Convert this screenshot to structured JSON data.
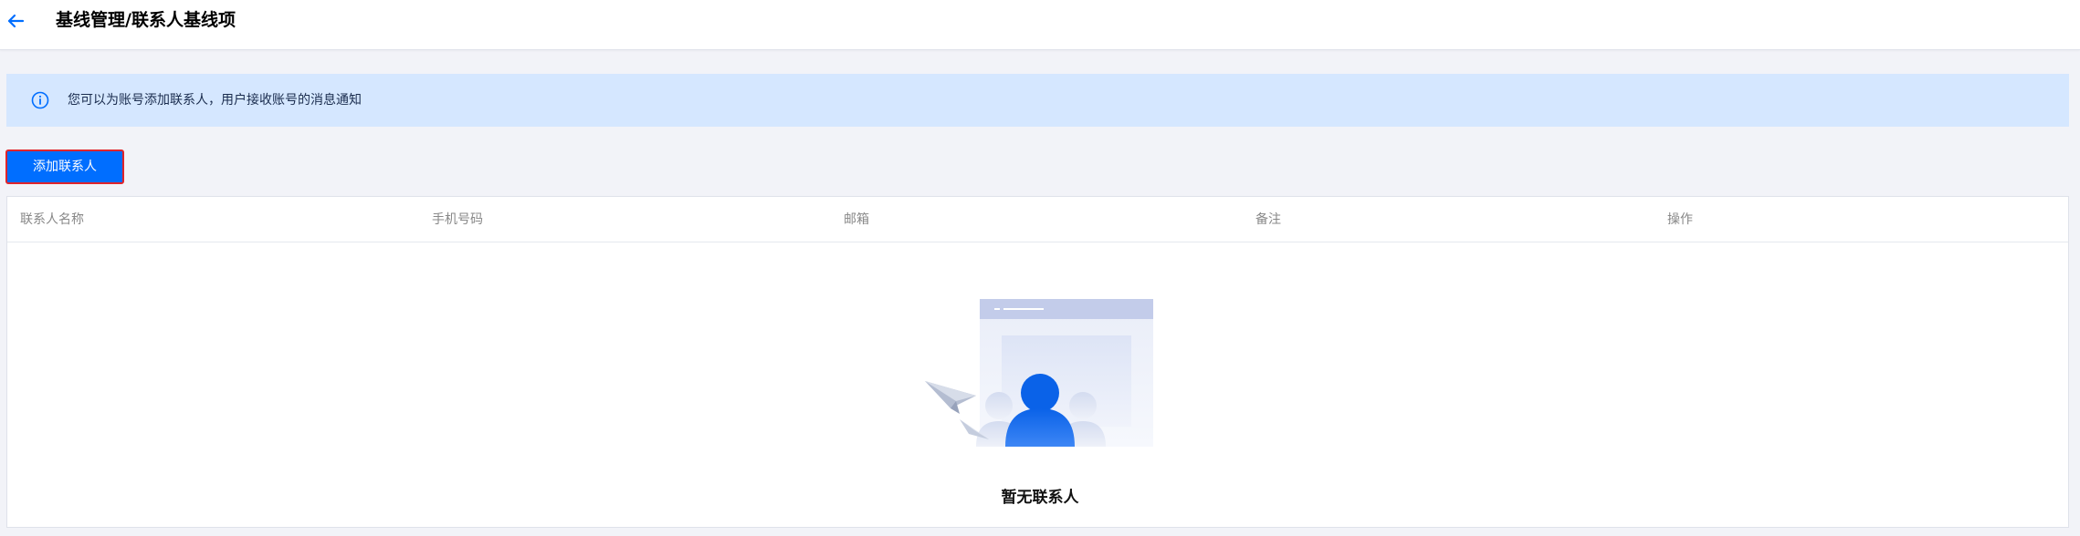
{
  "header": {
    "title": "基线管理/联系人基线项",
    "back_icon": "arrow-left-icon"
  },
  "notice": {
    "icon": "info-icon",
    "text": "您可以为账号添加联系人，用户接收账号的消息通知"
  },
  "toolbar": {
    "add_label": "添加联系人"
  },
  "table": {
    "columns": [
      "联系人名称",
      "手机号码",
      "邮箱",
      "备注",
      "操作"
    ],
    "rows": []
  },
  "empty_state": {
    "icon": "empty-contacts-illustration",
    "text": "暂无联系人"
  },
  "colors": {
    "primary": "#006eff",
    "notice_bg": "#d5e7ff",
    "page_bg": "#f2f3f8",
    "highlight_border": "#e0242b"
  }
}
